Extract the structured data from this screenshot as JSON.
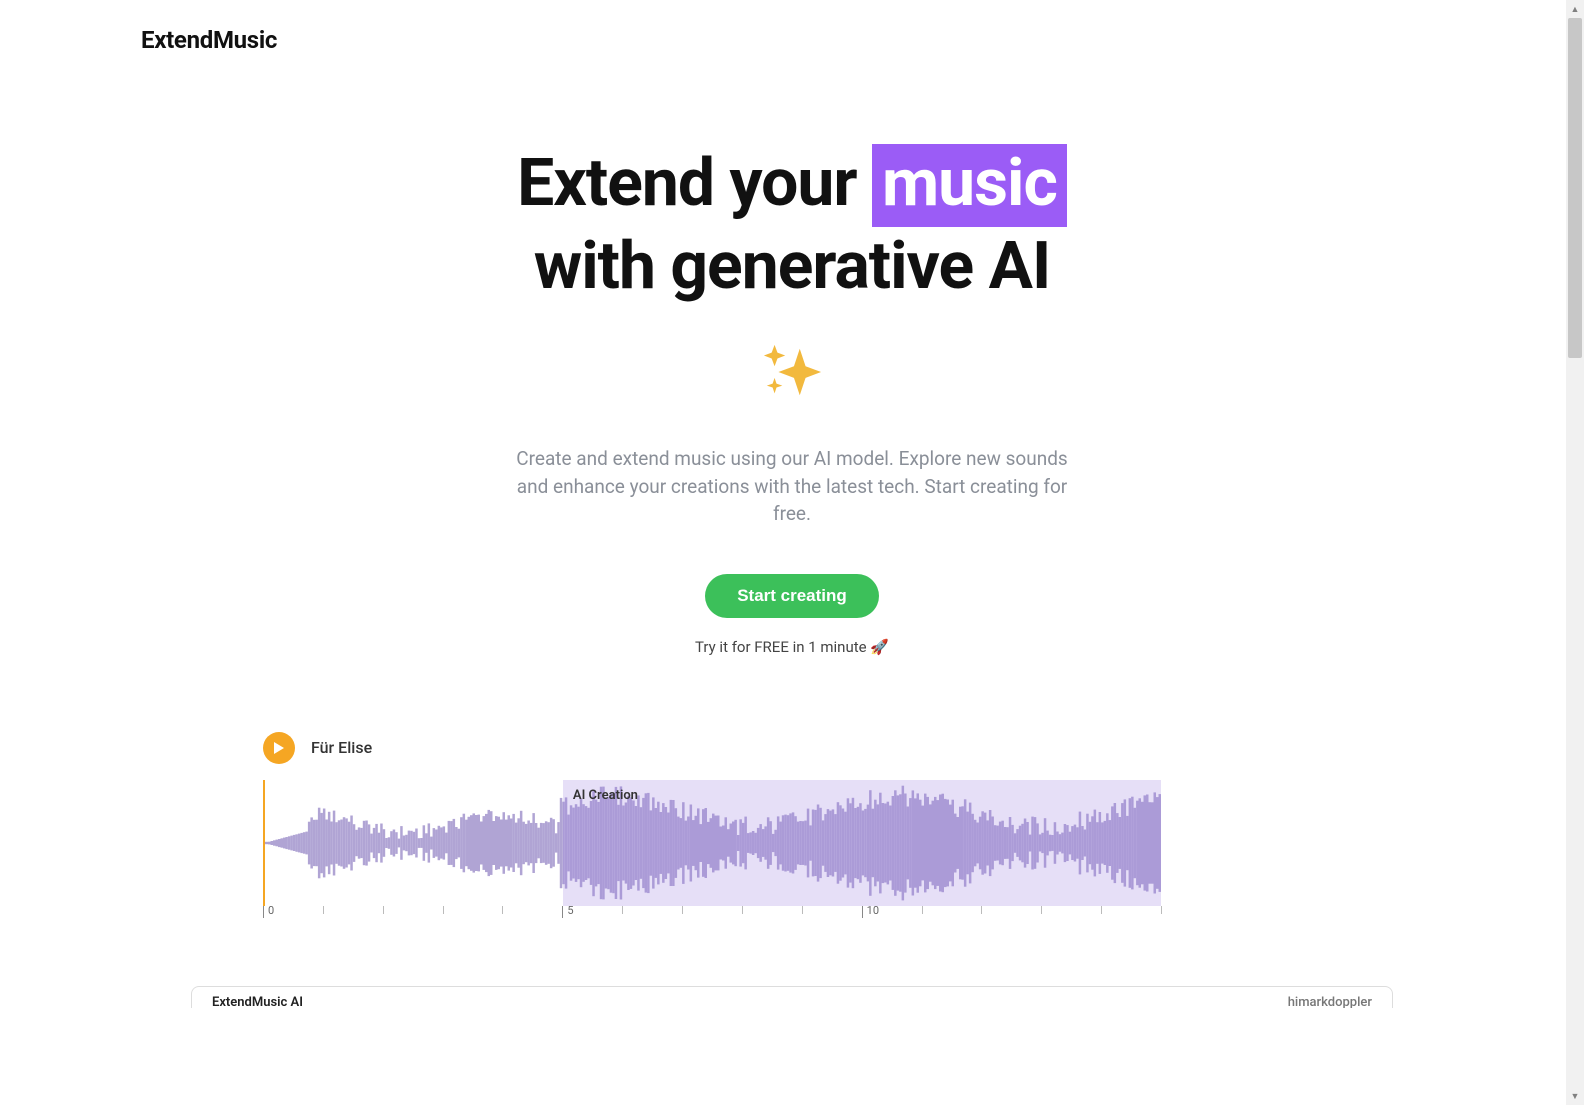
{
  "brand": "ExtendMusic",
  "hero": {
    "headline_prefix": "Extend your ",
    "headline_highlight": "music",
    "headline_line2": "with generative AI",
    "sparkle_icon": "sparkles-icon",
    "subcopy": "Create and extend music using our AI model. Explore new sounds and enhance your creations with the latest tech. Start creating for free.",
    "cta_label": "Start creating",
    "tagline": "Try it for FREE in 1 minute 🚀"
  },
  "player": {
    "track_title": "Für Elise",
    "ai_region_label": "AI Creation",
    "ai_region_start_fraction": 0.334,
    "timeline_majors": [
      0,
      5,
      10
    ],
    "timeline_range": 15,
    "timeline_minor_per_major": 5
  },
  "bottom": {
    "left": "ExtendMusic AI",
    "right": "himarkdoppler"
  },
  "colors": {
    "accent_purple": "#9b5cf6",
    "cta_green": "#3cc05a",
    "play_orange": "#f5a623",
    "subtext": "#8a8f98"
  }
}
